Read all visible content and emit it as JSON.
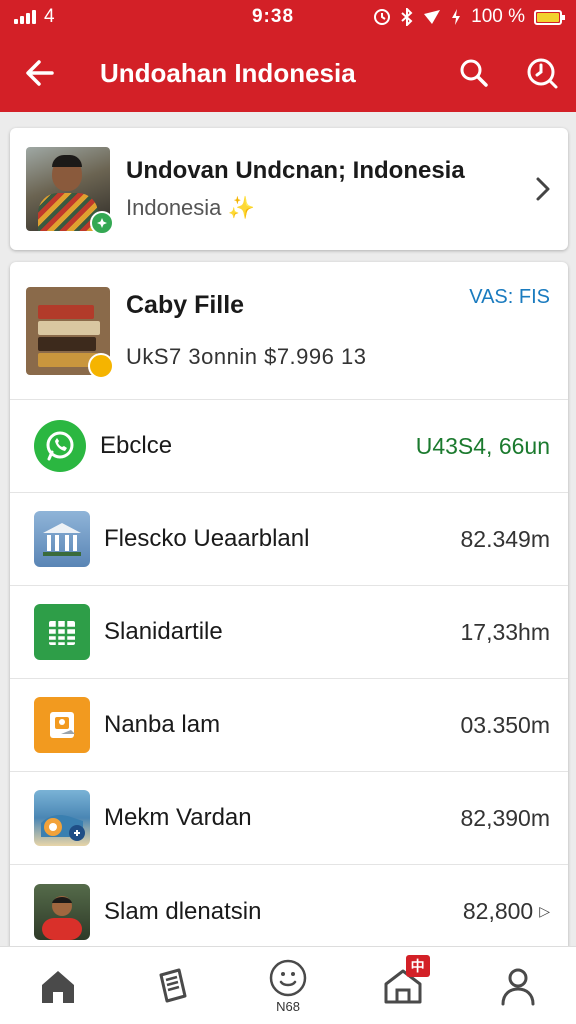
{
  "status_bar": {
    "carrier": "4",
    "time": "9:38",
    "battery": "100 %",
    "battery_level": 1.0,
    "battery_color": "#f2d22e"
  },
  "app_bar": {
    "title": "Undoahan Indonesia",
    "back_icon": "back-arrow-icon",
    "search_icon": "search-icon",
    "history_icon": "history-icon",
    "color": "#d32027"
  },
  "profile": {
    "name": "Undovan Undcnan; Indonesia",
    "subtitle": "Indonesia",
    "emoji": "✨"
  },
  "file": {
    "title": "Caby Fille",
    "subtitle": "UkS7 3onnin  $7.996 13",
    "tag": "VAS: FIS"
  },
  "rows": [
    {
      "label": "Ebclce",
      "value": "U43S4, 66un",
      "icon": "whatsapp-icon"
    },
    {
      "label": "Flescko Ueaarblanl",
      "value": "82.349m",
      "icon": "bank-building-icon"
    },
    {
      "label": "Slanidartile",
      "value": "17,33hm",
      "icon": "spreadsheet-icon"
    },
    {
      "label": "Nanba lam",
      "value": "03.350m",
      "icon": "image-card-icon"
    },
    {
      "label": "Mekm Vardan",
      "value": "82,390m",
      "icon": "travel-map-icon"
    },
    {
      "label": "Slam dlenatsin",
      "value": "82,800",
      "icon": "person-photo-icon"
    }
  ],
  "bottom_nav": {
    "home_icon": "home-icon",
    "doc_icon": "document-icon",
    "center_label": "N68",
    "center_icon": "smile-circle-icon",
    "store_icon": "store-icon",
    "store_badge": "中",
    "profile_icon": "person-icon"
  }
}
